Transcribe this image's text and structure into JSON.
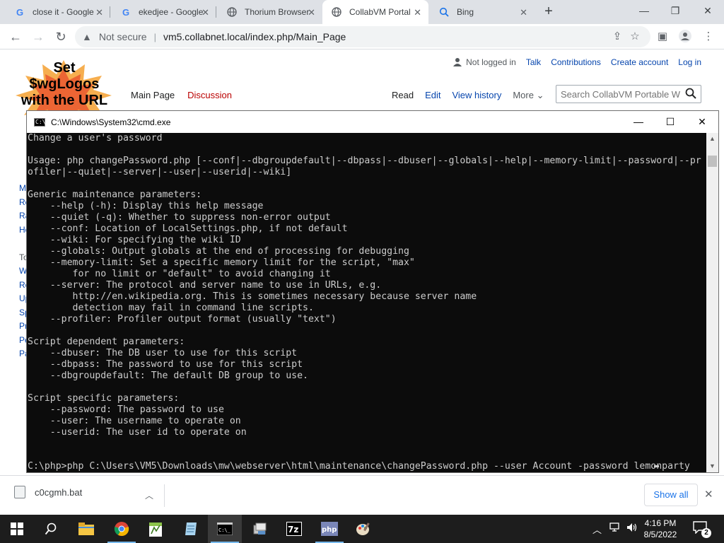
{
  "browser": {
    "tabs": [
      {
        "title": "close it - Google",
        "favicon": "G",
        "favicon_color": "#4285f4"
      },
      {
        "title": "ekedjee - Google",
        "favicon": "G",
        "favicon_color": "#4285f4"
      },
      {
        "title": "Thorium Browser",
        "favicon": "globe-icon",
        "favicon_color": "#5f6368"
      },
      {
        "title": "CollabVM Portal",
        "favicon": "globe-icon",
        "favicon_color": "#5f6368",
        "active": true
      },
      {
        "title": "Bing",
        "favicon": "search-icon",
        "favicon_color": "#1a73e8"
      }
    ],
    "omnibox": {
      "security": "Not secure",
      "url": "vm5.collabnet.local/index.php/Main_Page"
    }
  },
  "wiki": {
    "logo_text": "Set $wgLogos with the URL path",
    "personal": {
      "user_status": "Not logged in",
      "links": [
        "Talk",
        "Contributions",
        "Create account",
        "Log in"
      ]
    },
    "left_tabs": [
      "Main Page",
      "Discussion"
    ],
    "right_tabs": [
      "Read",
      "Edit",
      "View history",
      "More"
    ],
    "search_placeholder": "Search CollabVM Portable W",
    "sidebar_fragments": [
      "M",
      "Re",
      "Ra",
      "He",
      "",
      "To",
      "W",
      "Re",
      "Up",
      "Sp",
      "Pr",
      "Pe",
      "Pa"
    ]
  },
  "cmd": {
    "title": "C:\\Windows\\System32\\cmd.exe",
    "output": "Change a user's password\n\nUsage: php changePassword.php [--conf|--dbgroupdefault|--dbpass|--dbuser|--globals|--help|--memory-limit|--password|--pr\nofiler|--quiet|--server|--user|--userid|--wiki]\n\nGeneric maintenance parameters:\n    --help (-h): Display this help message\n    --quiet (-q): Whether to suppress non-error output\n    --conf: Location of LocalSettings.php, if not default\n    --wiki: For specifying the wiki ID\n    --globals: Output globals at the end of processing for debugging\n    --memory-limit: Set a specific memory limit for the script, \"max\"\n        for no limit or \"default\" to avoid changing it\n    --server: The protocol and server name to use in URLs, e.g.\n        http://en.wikipedia.org. This is sometimes necessary because server name\n        detection may fail in command line scripts.\n    --profiler: Profiler output format (usually \"text\")\n\nScript dependent parameters:\n    --dbuser: The DB user to use for this script\n    --dbpass: The password to use for this script\n    --dbgroupdefault: The default DB group to use.\n\nScript specific parameters:\n    --password: The password to use\n    --user: The username to operate on\n    --userid: The user id to operate on\n\n\nC:\\php>php C:\\Users\\VM5\\Downloads\\mw\\webserver\\html\\maintenance\\changePassword.php --user Account -password lemonparty"
  },
  "downloads": {
    "file_name": "c0cgmh.bat",
    "show_all": "Show all"
  },
  "taskbar": {
    "apps": [
      "file-explorer-icon",
      "chrome-icon",
      "notepad-plus-icon",
      "notepad-icon",
      "cmd-icon",
      "installer-icon",
      "7zip-icon",
      "php-icon",
      "paint-icon"
    ],
    "time": "4:16 PM",
    "date": "8/5/2022",
    "notification_count": "2"
  }
}
